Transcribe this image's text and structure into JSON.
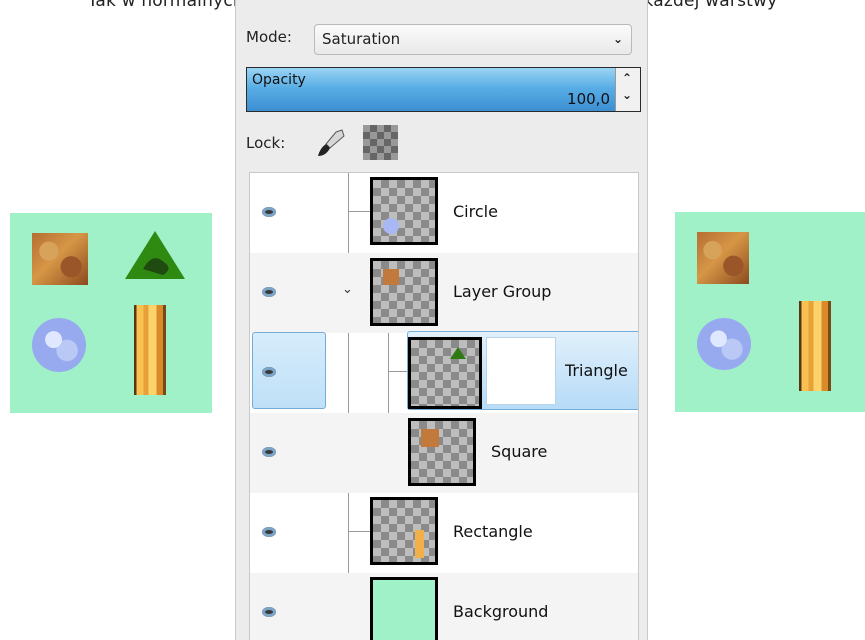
{
  "caption": "Tak w normalnych warstwach, można dodać maskę warstwy do każdej warstwy",
  "mode": {
    "label": "Mode:",
    "value": "Saturation"
  },
  "opacity": {
    "label": "Opacity",
    "value": "100,0"
  },
  "lock": {
    "label": "Lock:"
  },
  "layers": [
    {
      "name": "Circle",
      "visible": true,
      "selected": false
    },
    {
      "name": "Layer Group",
      "visible": true,
      "selected": false,
      "expanded": true
    },
    {
      "name": "Triangle",
      "visible": true,
      "selected": true,
      "has_mask": true
    },
    {
      "name": "Square",
      "visible": true,
      "selected": false
    },
    {
      "name": "Rectangle",
      "visible": true,
      "selected": false
    },
    {
      "name": "Background",
      "visible": true,
      "selected": false
    }
  ],
  "colors": {
    "canvas_background": "#a0f0c8",
    "selection": "#b6dbf7",
    "opacity_bar": "#5aaee6"
  },
  "icons": {
    "visibility": "eye-icon",
    "lock_pixels": "paintbrush-icon",
    "lock_alpha": "checkerboard-icon",
    "expander": "chevron-down-icon"
  }
}
